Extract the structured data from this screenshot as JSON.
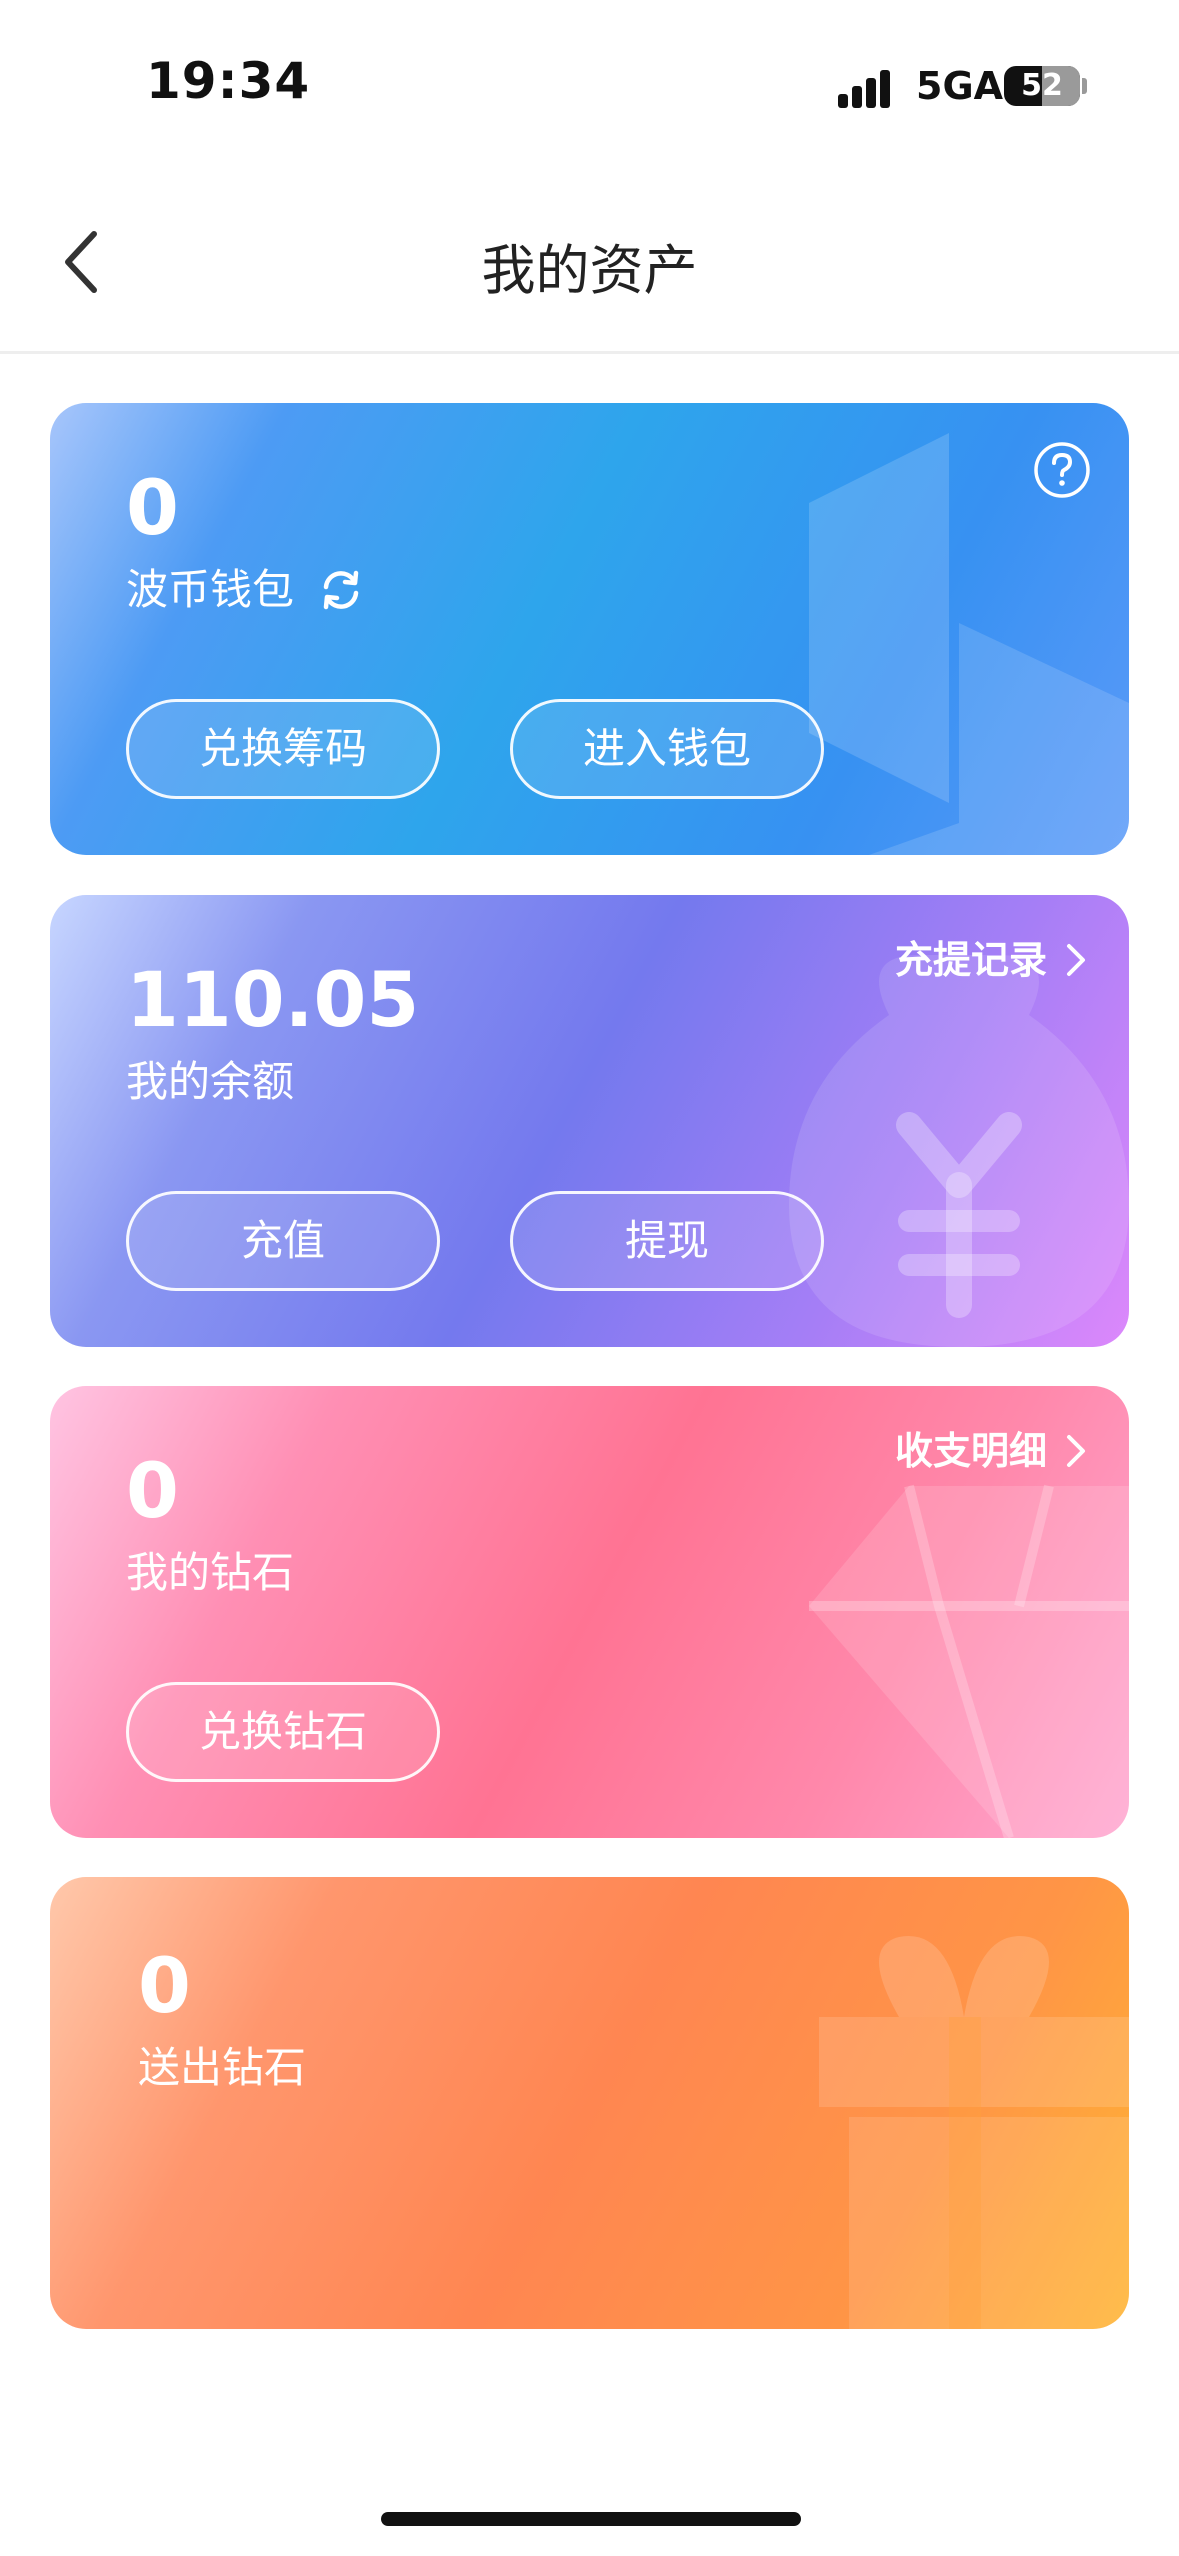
{
  "status_bar": {
    "time": "19:34",
    "network": "5GA",
    "battery": "52",
    "battery_level_percent": 52
  },
  "nav": {
    "title": "我的资产",
    "back_icon": "chevron-left-icon"
  },
  "cards": {
    "wallet": {
      "value": "0",
      "label": "波币钱包",
      "refresh_icon": "refresh-icon",
      "help_icon": "question-circle-icon",
      "button_1": "兑换筹码",
      "button_2": "进入钱包"
    },
    "balance": {
      "value": "110.05",
      "label": "我的余额",
      "link": "充提记录",
      "button_1": "充值",
      "button_2": "提现"
    },
    "diamond": {
      "value": "0",
      "label": "我的钻石",
      "link": "收支明细",
      "button_1": "兑换钻石"
    },
    "sent": {
      "value": "0",
      "label": "送出钻石"
    }
  },
  "colors": {
    "wallet_gradient": [
      "#a8c6fb",
      "#2ea5ec",
      "#5b9af8"
    ],
    "balance_gradient": [
      "#c7d6ff",
      "#7479ee",
      "#dc88fb"
    ],
    "diamond_gradient": [
      "#ffc4e2",
      "#ff7393",
      "#ffa7d0"
    ],
    "sent_gradient": [
      "#ffc8ab",
      "#ff8651",
      "#ffb433"
    ]
  }
}
